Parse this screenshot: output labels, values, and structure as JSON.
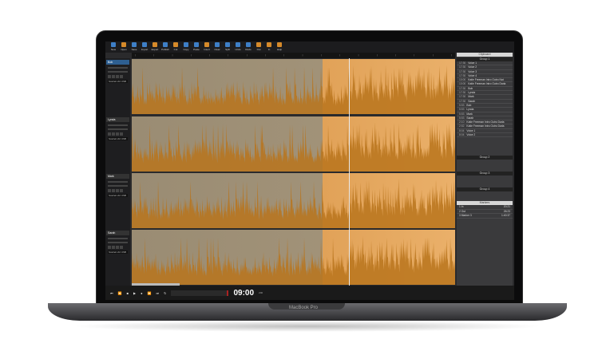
{
  "device": {
    "brand": "MacBook Pro"
  },
  "toolbar": [
    {
      "label": "New",
      "icon": "new-icon"
    },
    {
      "label": "Open",
      "icon": "open-icon"
    },
    {
      "label": "Save",
      "icon": "save-icon"
    },
    {
      "label": "Import",
      "icon": "import-icon"
    },
    {
      "label": "Export",
      "icon": "export-icon"
    },
    {
      "label": "Publish",
      "icon": "publish-icon"
    },
    {
      "label": "Cut",
      "icon": "cut-icon"
    },
    {
      "label": "Copy",
      "icon": "copy-icon"
    },
    {
      "label": "Paste",
      "icon": "paste-icon"
    },
    {
      "label": "Insert",
      "icon": "insert-icon"
    },
    {
      "label": "Clear",
      "icon": "clear-icon"
    },
    {
      "label": "Split",
      "icon": "split-icon"
    },
    {
      "label": "Undo",
      "icon": "undo-icon"
    },
    {
      "label": "Redo",
      "icon": "redo-icon"
    },
    {
      "label": "Out",
      "icon": "out-icon"
    },
    {
      "label": "In",
      "icon": "in-icon"
    },
    {
      "label": "Help",
      "icon": "help-icon"
    }
  ],
  "tracks": [
    {
      "name": "Bob",
      "channel": "Scarlett 2i2 USB"
    },
    {
      "name": "Lynda",
      "channel": "Scarlett 2i2 USB"
    },
    {
      "name": "Mark",
      "channel": "Scarlett 2i2 USB"
    },
    {
      "name": "Sarah",
      "channel": "Scarlett 2i2 USB"
    }
  ],
  "clips_panel": {
    "title": "Clipboard",
    "groups": [
      "Group 1",
      "Group 2",
      "Group 3",
      "Group 4"
    ],
    "items": [
      [
        "17:30",
        "Voice 1"
      ],
      [
        "17:30",
        "Voice 2"
      ],
      [
        "17:30",
        "Voice 3"
      ],
      [
        "17:30",
        "Voice 4"
      ],
      [
        "10:00",
        "Katie Freeman Intro Outro Nat"
      ],
      [
        "10:00",
        "Katie Freeman Intro Outro Darla"
      ],
      [
        "17:30",
        "Bob"
      ],
      [
        "17:30",
        "Lynda"
      ],
      [
        "17:30",
        "Mark"
      ],
      [
        "17:30",
        "Sarah"
      ],
      [
        "5:53",
        "Bob"
      ],
      [
        "5:53",
        "Lynda"
      ],
      [
        "5:53",
        "Mark"
      ],
      [
        "5:53",
        "Sarah"
      ],
      [
        "2:10",
        "Katie Freeman Intro Outro Darla"
      ],
      [
        "2:52",
        "Katie Freeman Intro Outro Darla"
      ],
      [
        "8:04",
        "Voice 1"
      ],
      [
        "8:04",
        "Voice 2"
      ]
    ]
  },
  "markers": {
    "title": "Markers",
    "items": [
      {
        "name": "1 In",
        "time": "20:21"
      },
      {
        "name": "2 Out",
        "time": "26:23"
      },
      {
        "name": "3 Marker 3",
        "time": "1:40:37"
      }
    ]
  },
  "transport": {
    "timecode": "09:00",
    "sub": "200"
  },
  "colors": {
    "waveform_played": "#b8741c",
    "waveform_unplayed": "#c47e22",
    "accent": "#2e5f91"
  }
}
